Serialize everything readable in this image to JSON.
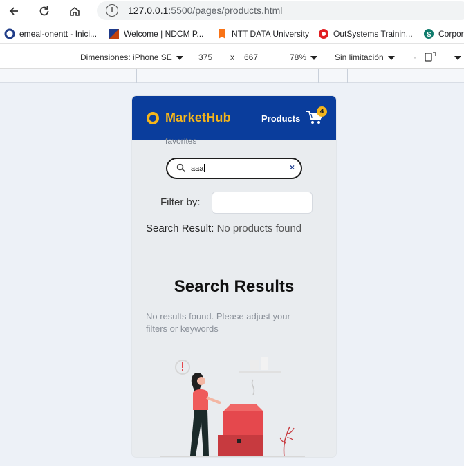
{
  "browser": {
    "url_host": "127.0.0.1",
    "url_rest": ":5500/pages/products.html",
    "bookmarks": [
      {
        "label": "emeal-onentt - Inici...",
        "color": "#1f3c88"
      },
      {
        "label": "Welcome | NDCM P...",
        "color": "#c2410c"
      },
      {
        "label": "NTT DATA University",
        "color": "#f97316"
      },
      {
        "label": "OutSystems Trainin...",
        "color": "#e11d21"
      },
      {
        "label": "Corpor",
        "color": "#0f7b6c"
      }
    ]
  },
  "devtools": {
    "device": "Dimensiones: iPhone SE",
    "width": "375",
    "times": "x",
    "height": "667",
    "zoom": "78%",
    "throttle": "Sin limitación"
  },
  "app": {
    "brand": "MarketHub",
    "nav_products": "Products",
    "cart_count": "4",
    "favorites_clip": "favorites",
    "search_value": "aaa",
    "search_clear": "×",
    "filter_label": "Filter by:",
    "result_key": "Search Result:",
    "result_value": "No products found",
    "results_title": "Search Results",
    "results_message": "No results found. Please adjust your filters or keywords",
    "colors": {
      "header": "#0a3d9c",
      "brand": "#f5b51b",
      "illustration_box": "#e5484d"
    }
  }
}
